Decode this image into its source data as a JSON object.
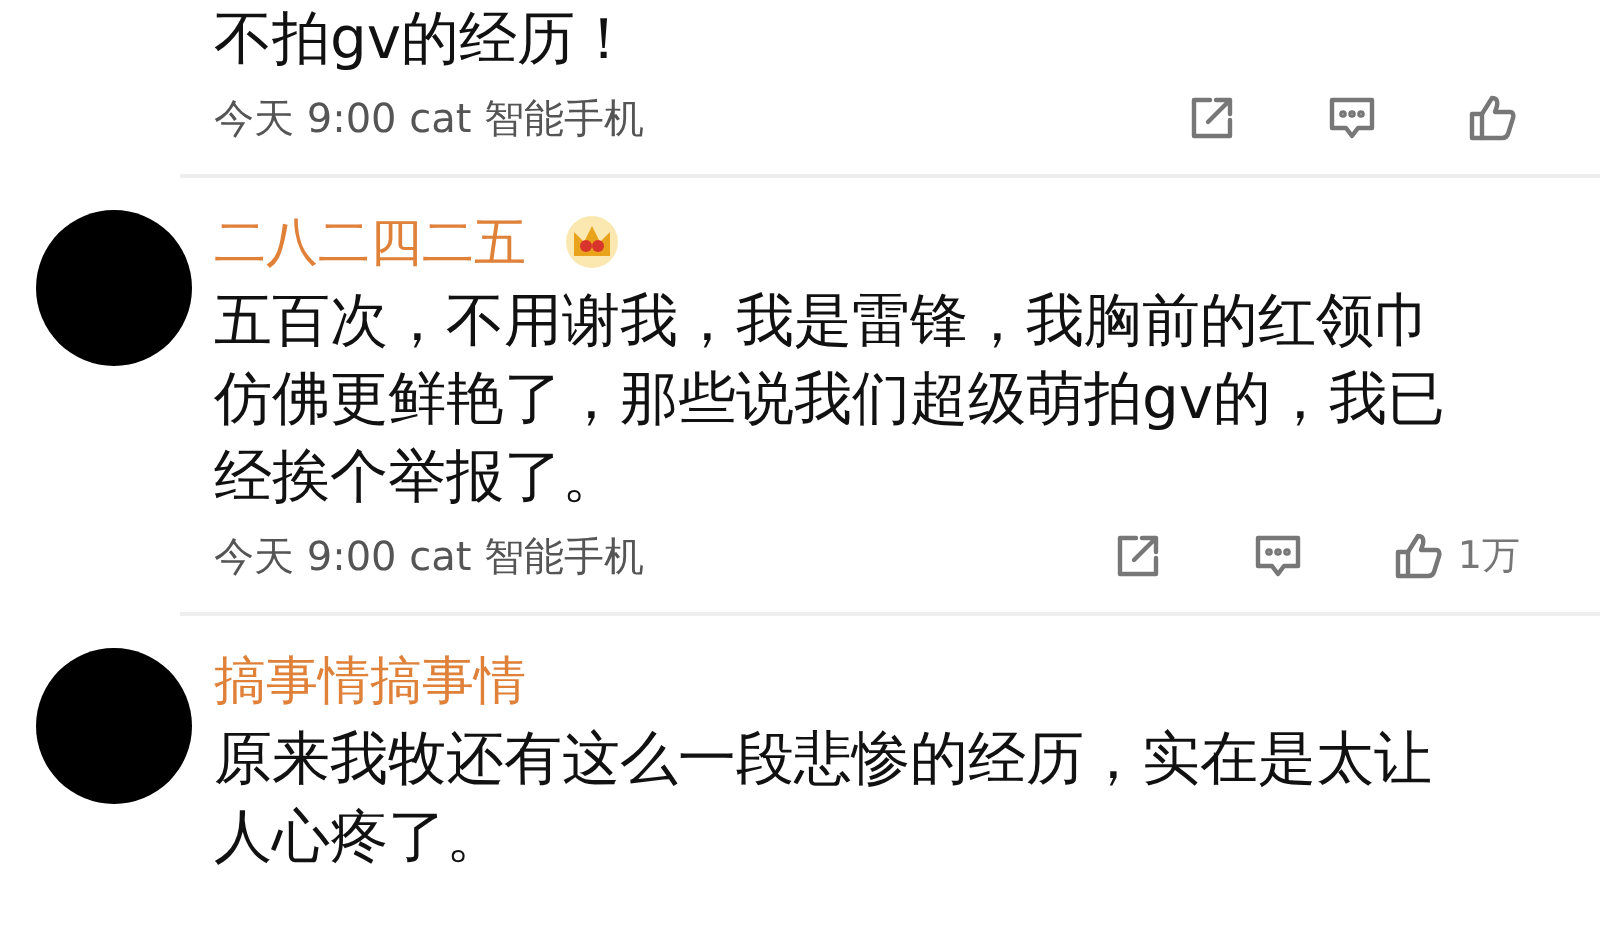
{
  "comments": [
    {
      "text": "不拍gv的经历！",
      "meta": "今天 9:00 cat 智能手机",
      "actions": true
    },
    {
      "avatar": true,
      "name": "二八二四二五",
      "vip_badge": true,
      "text": "五百次，不用谢我，我是雷锋，我胸前的红领巾仿佛更鲜艳了，那些说我们超级萌拍gv的，我已经挨个举报了。",
      "meta": "今天 9:00 cat 智能手机",
      "actions": true,
      "likes": "1万"
    },
    {
      "avatar": true,
      "name": "搞事情搞事情",
      "text": "原来我牧还有这么一段悲惨的经历，实在是太让人心疼了。"
    }
  ]
}
